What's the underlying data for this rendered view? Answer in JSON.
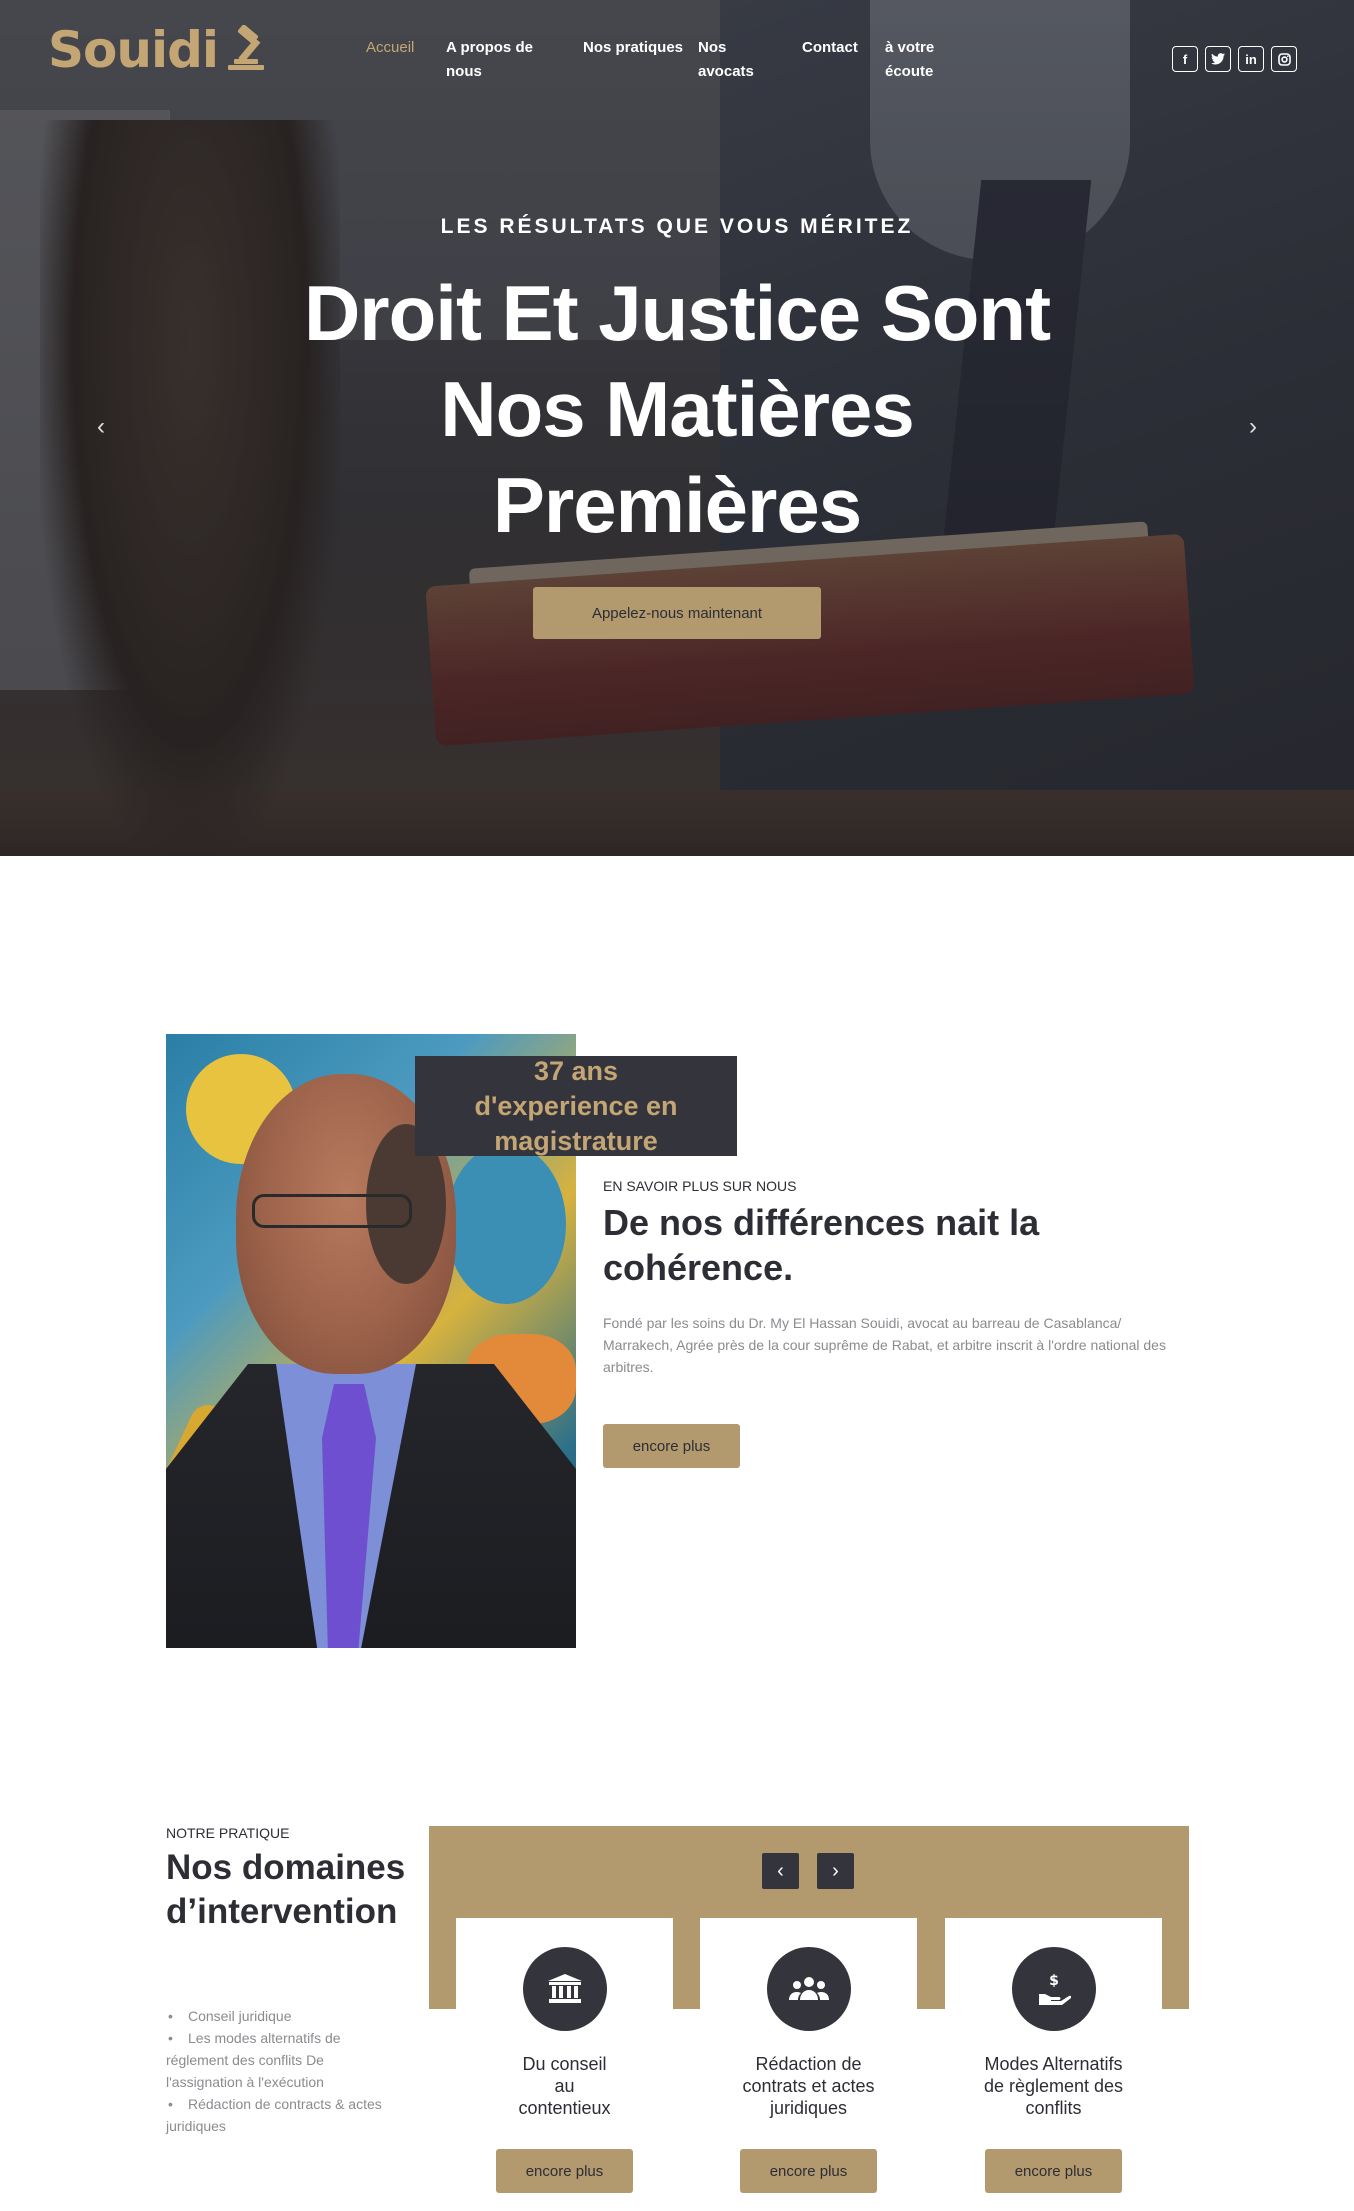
{
  "brand": {
    "logo_text": "Souidi",
    "accent": "#b29a6e",
    "dark": "#34353c"
  },
  "nav": {
    "items": [
      {
        "label": "Accueil",
        "active": true
      },
      {
        "label": "A propos de nous",
        "active": false
      },
      {
        "label": "Nos pratiques",
        "active": false
      },
      {
        "label": "Nos avocats",
        "active": false
      },
      {
        "label": "Contact",
        "active": false
      },
      {
        "label": "à votre écoute",
        "active": false
      }
    ]
  },
  "socials": [
    {
      "icon": "facebook-icon",
      "glyph": "f"
    },
    {
      "icon": "twitter-icon",
      "glyph": "🐦"
    },
    {
      "icon": "linkedin-icon",
      "glyph": "in"
    },
    {
      "icon": "instagram-icon",
      "glyph": "◎"
    }
  ],
  "hero": {
    "kicker": "LES RÉSULTATS QUE VOUS MÉRITEZ",
    "title": "Droit Et Justice Sont Nos Matières Premières",
    "cta": "Appelez-nous maintenant",
    "prev_icon": "chevron-left-icon",
    "next_icon": "chevron-right-icon"
  },
  "about": {
    "experience": "37 ans d'experience en magistrature",
    "kicker": "EN SAVOIR PLUS SUR NOUS",
    "title": "De nos différences nait la cohérence.",
    "text": "Fondé par les soins du Dr. My El Hassan Souidi, avocat au barreau de Casablanca/ Marrakech, Agrée près de la cour suprême de Rabat, et arbitre inscrit à l'ordre national des arbitres.",
    "cta": "encore plus"
  },
  "practice": {
    "kicker": "NOTRE PRATIQUE",
    "title": "Nos domaines d’intervention",
    "list": [
      "Conseil juridique",
      "Les modes alternatifs de réglement des conflits De l'assignation à l'exécution",
      "Rédaction de contracts & actes juridiques"
    ],
    "cards": [
      {
        "icon": "courthouse-icon",
        "title": "Du conseil au contentieux",
        "cta": "encore plus"
      },
      {
        "icon": "people-group-icon",
        "title": "Rédaction de contrats et actes juridiques",
        "cta": "encore plus"
      },
      {
        "icon": "hand-dollar-icon",
        "title": "Modes Alternatifs de règlement des conflits",
        "cta": "encore plus"
      }
    ]
  }
}
